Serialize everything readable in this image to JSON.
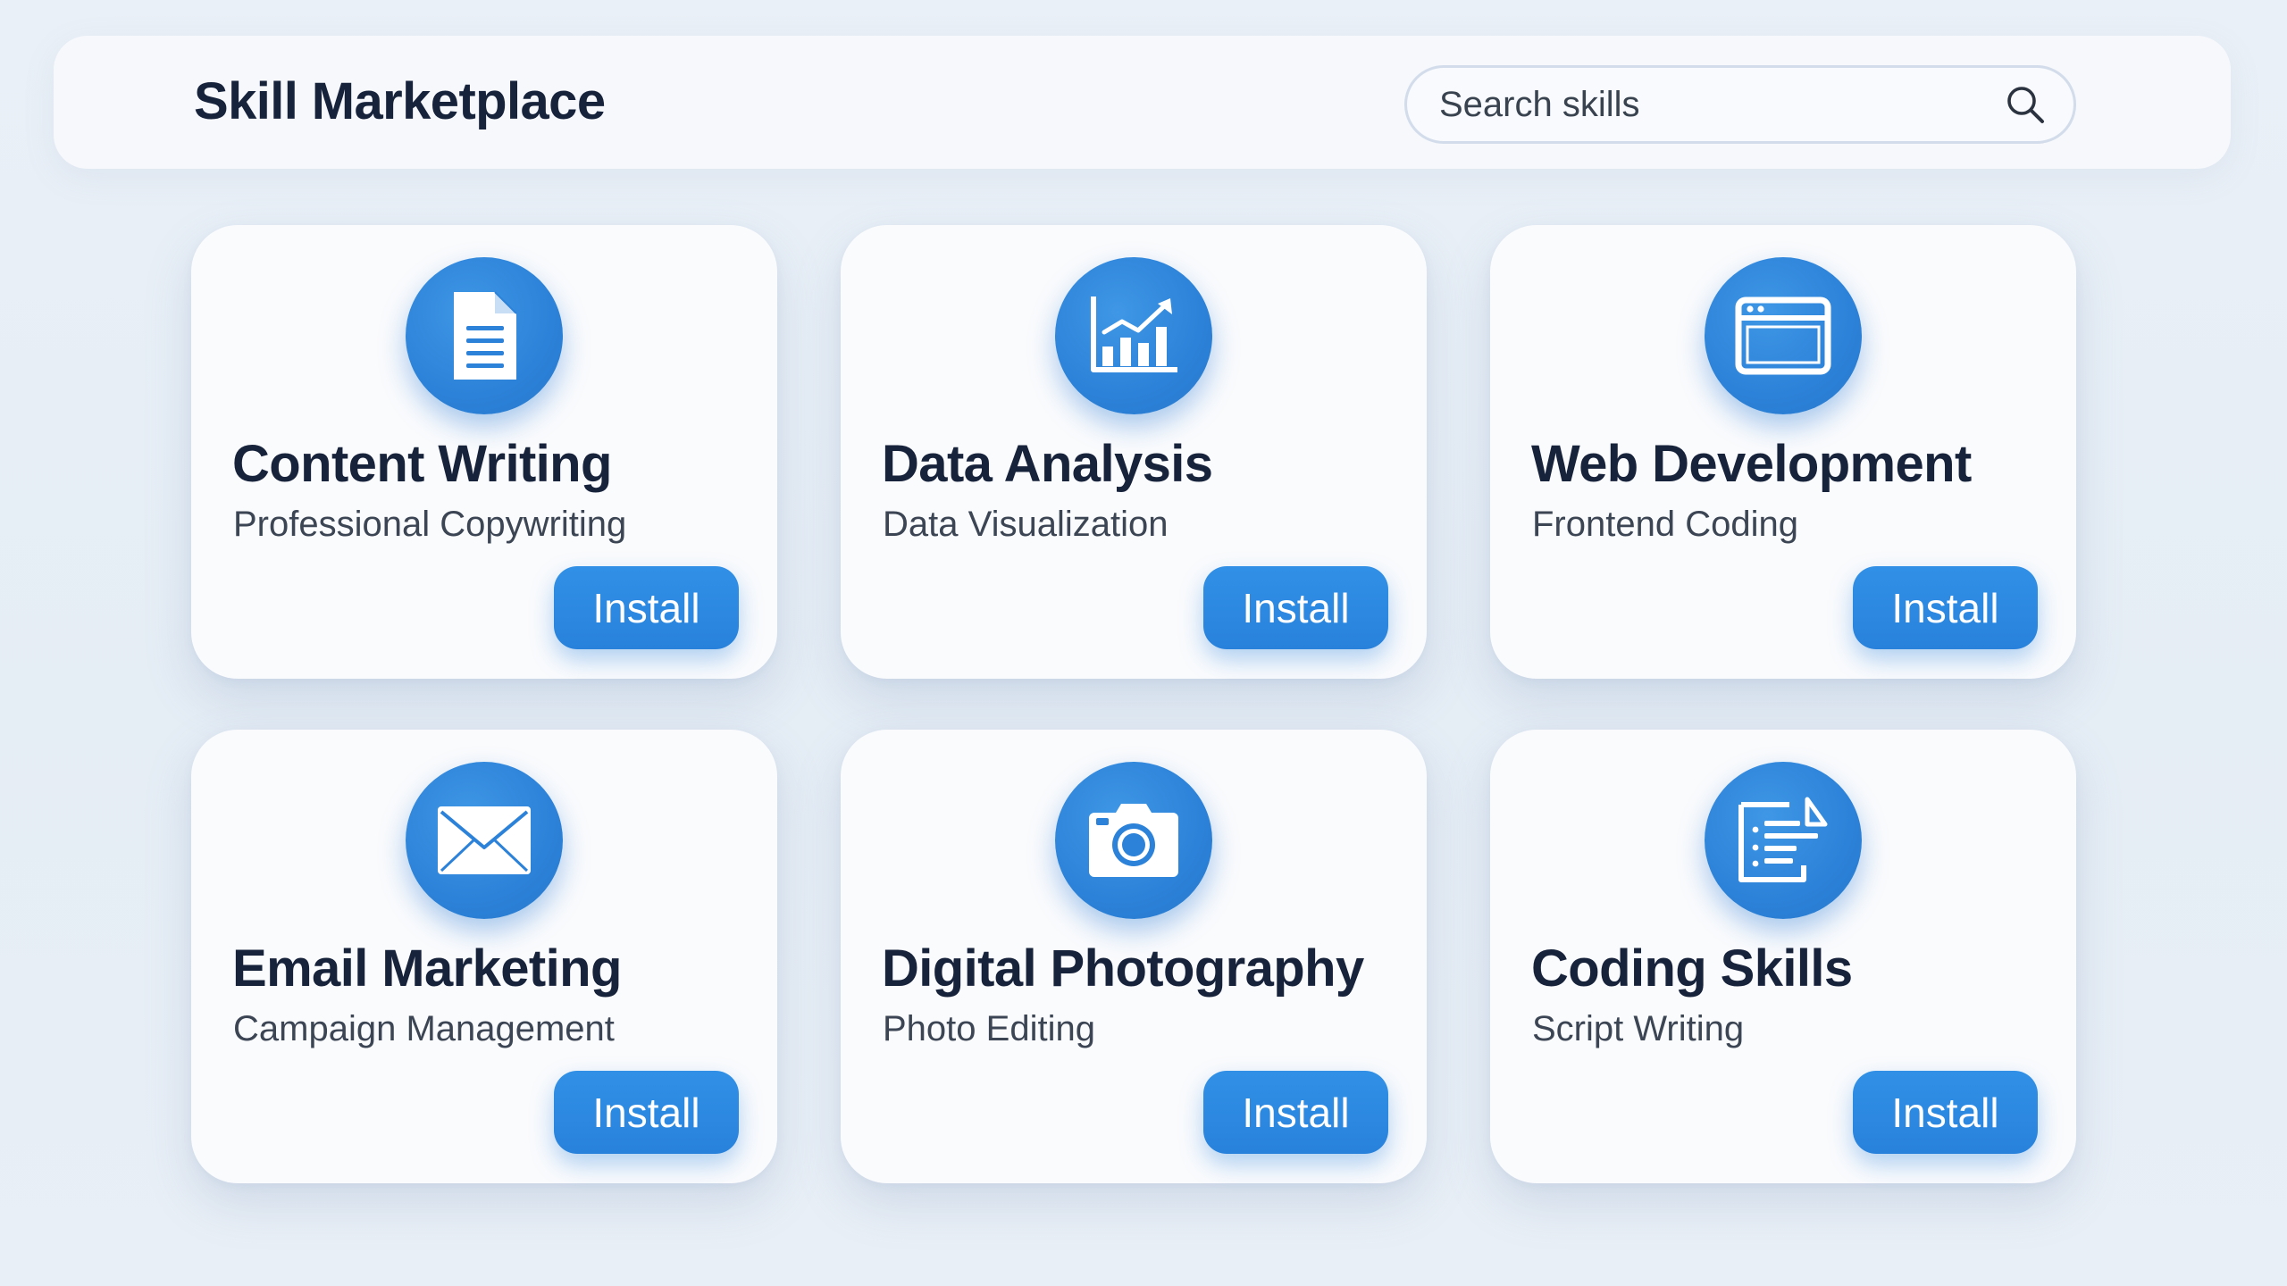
{
  "header": {
    "title": "Skill Marketplace",
    "search_placeholder": "Search skills",
    "search_icon": "search-icon"
  },
  "accent_color": "#2b84da",
  "skills": [
    {
      "title": "Content Writing",
      "subtitle": "Professional Copywriting",
      "icon": "document-icon",
      "button_label": "Install"
    },
    {
      "title": "Data Analysis",
      "subtitle": "Data Visualization",
      "icon": "chart-icon",
      "button_label": "Install"
    },
    {
      "title": "Web Development",
      "subtitle": "Frontend Coding",
      "icon": "browser-window-icon",
      "button_label": "Install"
    },
    {
      "title": "Email Marketing",
      "subtitle": "Campaign Management",
      "icon": "envelope-icon",
      "button_label": "Install"
    },
    {
      "title": "Digital Photography",
      "subtitle": "Photo Editing",
      "icon": "camera-icon",
      "button_label": "Install"
    },
    {
      "title": "Coding Skills",
      "subtitle": "Script Writing",
      "icon": "script-icon",
      "button_label": "Install"
    }
  ]
}
